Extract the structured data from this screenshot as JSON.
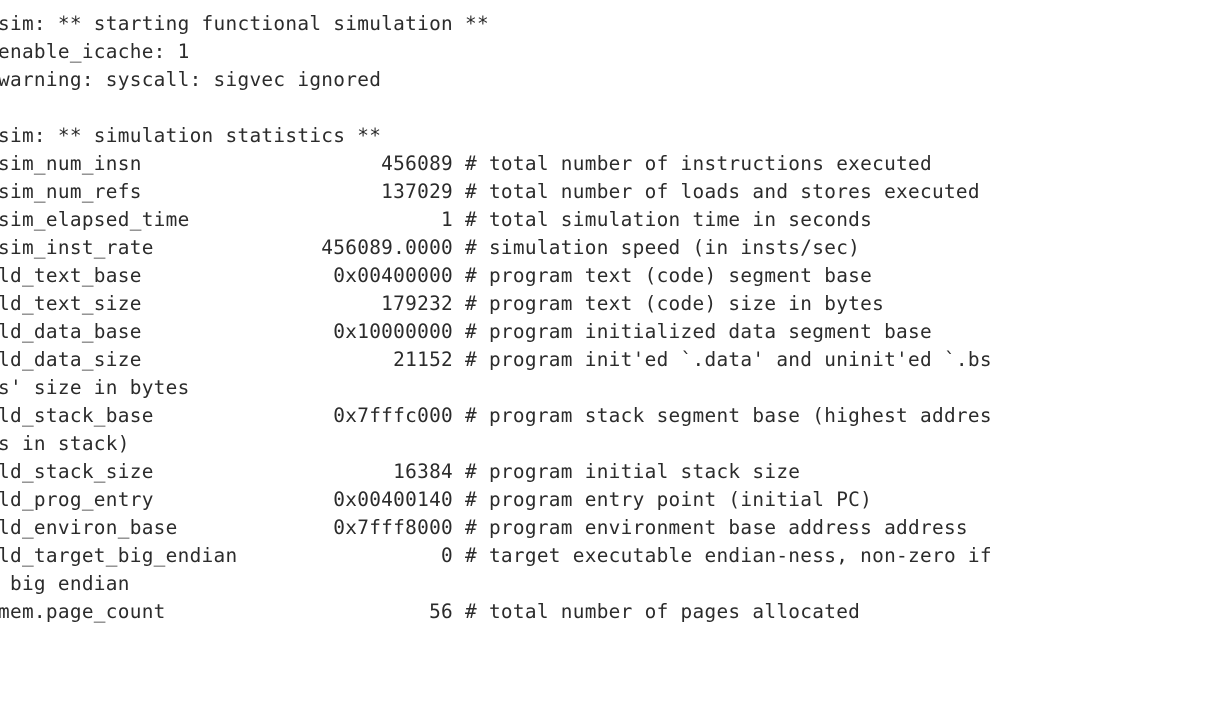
{
  "terminal": {
    "type": "console-output",
    "program": "sim",
    "background_color": "#ffffff",
    "text_color": "#2b2b2b",
    "lines": [
      "sim: ** starting functional simulation **",
      "enable_icache: 1",
      "warning: syscall: sigvec ignored",
      "",
      "sim: ** simulation statistics **",
      "sim_num_insn                    456089 # total number of instructions executed",
      "sim_num_refs                    137029 # total number of loads and stores executed",
      "sim_elapsed_time                     1 # total simulation time in seconds",
      "sim_inst_rate              456089.0000 # simulation speed (in insts/sec)",
      "ld_text_base                0x00400000 # program text (code) segment base",
      "ld_text_size                    179232 # program text (code) size in bytes",
      "ld_data_base                0x10000000 # program initialized data segment base",
      "ld_data_size                     21152 # program init'ed `.data' and uninit'ed `.bs",
      "s' size in bytes",
      "ld_stack_base               0x7fffc000 # program stack segment base (highest addres",
      "s in stack)",
      "ld_stack_size                    16384 # program initial stack size",
      "ld_prog_entry               0x00400140 # program entry point (initial PC)",
      "ld_environ_base             0x7fff8000 # program environment base address address",
      "ld_target_big_endian                 0 # target executable endian-ness, non-zero if",
      " big endian",
      "mem.page_count                      56 # total number of pages allocated"
    ],
    "statistics": [
      {
        "name": "sim_num_insn",
        "value": "456089",
        "comment": "total number of instructions executed"
      },
      {
        "name": "sim_num_refs",
        "value": "137029",
        "comment": "total number of loads and stores executed"
      },
      {
        "name": "sim_elapsed_time",
        "value": "1",
        "comment": "total simulation time in seconds"
      },
      {
        "name": "sim_inst_rate",
        "value": "456089.0000",
        "comment": "simulation speed (in insts/sec)"
      },
      {
        "name": "ld_text_base",
        "value": "0x00400000",
        "comment": "program text (code) segment base"
      },
      {
        "name": "ld_text_size",
        "value": "179232",
        "comment": "program text (code) size in bytes"
      },
      {
        "name": "ld_data_base",
        "value": "0x10000000",
        "comment": "program initialized data segment base"
      },
      {
        "name": "ld_data_size",
        "value": "21152",
        "comment": "program init'ed `.data' and uninit'ed `.bss' size in bytes"
      },
      {
        "name": "ld_stack_base",
        "value": "0x7fffc000",
        "comment": "program stack segment base (highest address in stack)"
      },
      {
        "name": "ld_stack_size",
        "value": "16384",
        "comment": "program initial stack size"
      },
      {
        "name": "ld_prog_entry",
        "value": "0x00400140",
        "comment": "program entry point (initial PC)"
      },
      {
        "name": "ld_environ_base",
        "value": "0x7fff8000",
        "comment": "program environment base address address"
      },
      {
        "name": "ld_target_big_endian",
        "value": "0",
        "comment": "target executable endian-ness, non-zero if big endian"
      },
      {
        "name": "mem.page_count",
        "value": "56",
        "comment": "total number of pages allocated"
      }
    ],
    "messages": [
      "sim: ** starting functional simulation **",
      "enable_icache: 1",
      "warning: syscall: sigvec ignored",
      "sim: ** simulation statistics **"
    ]
  }
}
